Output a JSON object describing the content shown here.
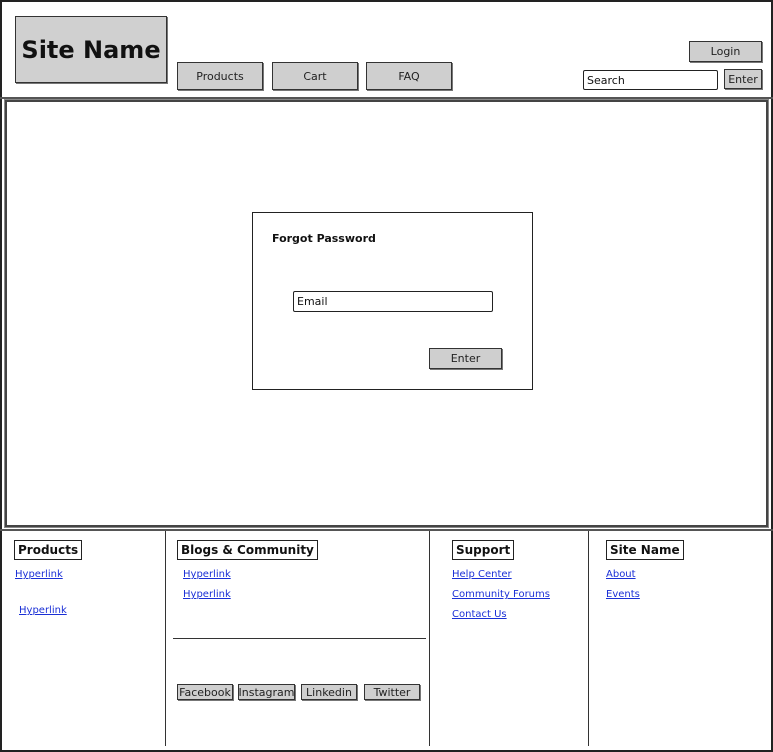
{
  "header": {
    "site_name": "Site Name",
    "nav": [
      "Products",
      "Cart",
      "FAQ"
    ],
    "login_label": "Login",
    "search_placeholder": "Search",
    "search_button": "Enter"
  },
  "dialog": {
    "title": "Forgot Password",
    "email_placeholder": "Email",
    "submit_label": "Enter"
  },
  "footer": {
    "products": {
      "heading": "Products",
      "links": [
        "Hyperlink",
        "Hyperlink"
      ]
    },
    "blogs": {
      "heading": "Blogs & Community",
      "links": [
        "Hyperlink",
        "Hyperlink"
      ]
    },
    "social": [
      "Facebook",
      "Instagram",
      "Linkedin",
      "Twitter"
    ],
    "support": {
      "heading": "Support",
      "links": [
        "Help Center",
        "Community Forums",
        "Contact Us"
      ]
    },
    "site": {
      "heading": "Site Name",
      "links": [
        "About",
        "Events"
      ]
    }
  }
}
